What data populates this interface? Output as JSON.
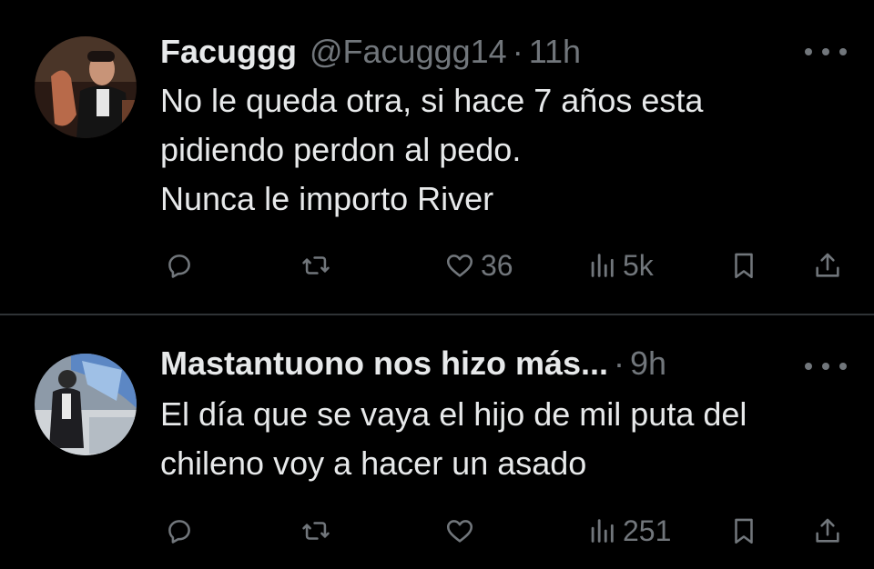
{
  "tweets": [
    {
      "name": "Facuggg",
      "handle": "@Facuggg14",
      "separator": "·",
      "time": "11h",
      "lines": [
        "No le queda otra, si hace 7 años esta",
        "pidiendo perdon al pedo.",
        "Nunca le importo River"
      ],
      "likes": "36",
      "views": "5k"
    },
    {
      "name": "Mastantuono nos hizo más...",
      "separator": "·",
      "time": "9h",
      "lines": [
        "El día que se vaya el hijo de mil puta del",
        "chileno voy a hacer un asado"
      ],
      "likes": "",
      "views": "251"
    }
  ],
  "icons": {
    "reply": "reply-icon",
    "retweet": "retweet-icon",
    "like": "heart-icon",
    "views": "views-icon",
    "bookmark": "bookmark-icon",
    "share": "share-icon",
    "more": "more-icon"
  },
  "colors": {
    "background": "#000000",
    "text": "#e7e9ea",
    "muted": "#71767b",
    "divider": "#2f3336"
  }
}
